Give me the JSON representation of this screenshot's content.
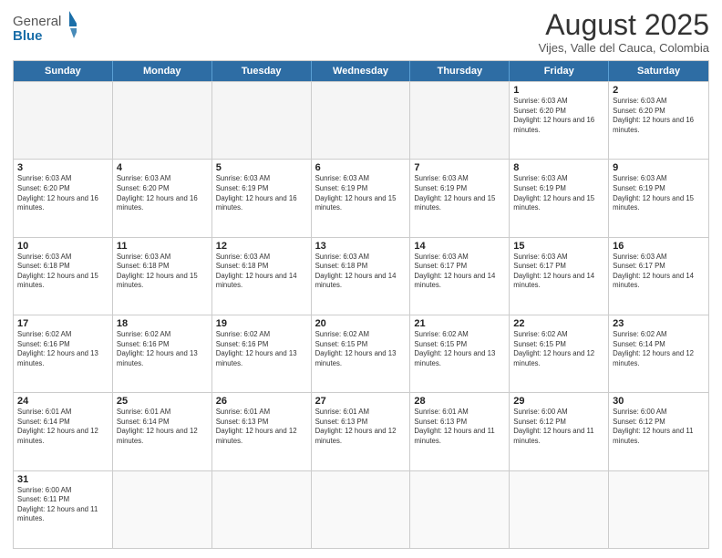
{
  "header": {
    "logo_general": "General",
    "logo_blue": "Blue",
    "month_title": "August 2025",
    "subtitle": "Vijes, Valle del Cauca, Colombia"
  },
  "weekdays": [
    "Sunday",
    "Monday",
    "Tuesday",
    "Wednesday",
    "Thursday",
    "Friday",
    "Saturday"
  ],
  "weeks": [
    [
      {
        "day": "",
        "empty": true
      },
      {
        "day": "",
        "empty": true
      },
      {
        "day": "",
        "empty": true
      },
      {
        "day": "",
        "empty": true
      },
      {
        "day": "",
        "empty": true
      },
      {
        "day": "1",
        "sunrise": "6:03 AM",
        "sunset": "6:20 PM",
        "daylight": "12 hours and 16 minutes."
      },
      {
        "day": "2",
        "sunrise": "6:03 AM",
        "sunset": "6:20 PM",
        "daylight": "12 hours and 16 minutes."
      }
    ],
    [
      {
        "day": "3",
        "sunrise": "6:03 AM",
        "sunset": "6:20 PM",
        "daylight": "12 hours and 16 minutes."
      },
      {
        "day": "4",
        "sunrise": "6:03 AM",
        "sunset": "6:20 PM",
        "daylight": "12 hours and 16 minutes."
      },
      {
        "day": "5",
        "sunrise": "6:03 AM",
        "sunset": "6:19 PM",
        "daylight": "12 hours and 16 minutes."
      },
      {
        "day": "6",
        "sunrise": "6:03 AM",
        "sunset": "6:19 PM",
        "daylight": "12 hours and 15 minutes."
      },
      {
        "day": "7",
        "sunrise": "6:03 AM",
        "sunset": "6:19 PM",
        "daylight": "12 hours and 15 minutes."
      },
      {
        "day": "8",
        "sunrise": "6:03 AM",
        "sunset": "6:19 PM",
        "daylight": "12 hours and 15 minutes."
      },
      {
        "day": "9",
        "sunrise": "6:03 AM",
        "sunset": "6:19 PM",
        "daylight": "12 hours and 15 minutes."
      }
    ],
    [
      {
        "day": "10",
        "sunrise": "6:03 AM",
        "sunset": "6:18 PM",
        "daylight": "12 hours and 15 minutes."
      },
      {
        "day": "11",
        "sunrise": "6:03 AM",
        "sunset": "6:18 PM",
        "daylight": "12 hours and 15 minutes."
      },
      {
        "day": "12",
        "sunrise": "6:03 AM",
        "sunset": "6:18 PM",
        "daylight": "12 hours and 14 minutes."
      },
      {
        "day": "13",
        "sunrise": "6:03 AM",
        "sunset": "6:18 PM",
        "daylight": "12 hours and 14 minutes."
      },
      {
        "day": "14",
        "sunrise": "6:03 AM",
        "sunset": "6:17 PM",
        "daylight": "12 hours and 14 minutes."
      },
      {
        "day": "15",
        "sunrise": "6:03 AM",
        "sunset": "6:17 PM",
        "daylight": "12 hours and 14 minutes."
      },
      {
        "day": "16",
        "sunrise": "6:03 AM",
        "sunset": "6:17 PM",
        "daylight": "12 hours and 14 minutes."
      }
    ],
    [
      {
        "day": "17",
        "sunrise": "6:02 AM",
        "sunset": "6:16 PM",
        "daylight": "12 hours and 13 minutes."
      },
      {
        "day": "18",
        "sunrise": "6:02 AM",
        "sunset": "6:16 PM",
        "daylight": "12 hours and 13 minutes."
      },
      {
        "day": "19",
        "sunrise": "6:02 AM",
        "sunset": "6:16 PM",
        "daylight": "12 hours and 13 minutes."
      },
      {
        "day": "20",
        "sunrise": "6:02 AM",
        "sunset": "6:15 PM",
        "daylight": "12 hours and 13 minutes."
      },
      {
        "day": "21",
        "sunrise": "6:02 AM",
        "sunset": "6:15 PM",
        "daylight": "12 hours and 13 minutes."
      },
      {
        "day": "22",
        "sunrise": "6:02 AM",
        "sunset": "6:15 PM",
        "daylight": "12 hours and 12 minutes."
      },
      {
        "day": "23",
        "sunrise": "6:02 AM",
        "sunset": "6:14 PM",
        "daylight": "12 hours and 12 minutes."
      }
    ],
    [
      {
        "day": "24",
        "sunrise": "6:01 AM",
        "sunset": "6:14 PM",
        "daylight": "12 hours and 12 minutes."
      },
      {
        "day": "25",
        "sunrise": "6:01 AM",
        "sunset": "6:14 PM",
        "daylight": "12 hours and 12 minutes."
      },
      {
        "day": "26",
        "sunrise": "6:01 AM",
        "sunset": "6:13 PM",
        "daylight": "12 hours and 12 minutes."
      },
      {
        "day": "27",
        "sunrise": "6:01 AM",
        "sunset": "6:13 PM",
        "daylight": "12 hours and 12 minutes."
      },
      {
        "day": "28",
        "sunrise": "6:01 AM",
        "sunset": "6:13 PM",
        "daylight": "12 hours and 11 minutes."
      },
      {
        "day": "29",
        "sunrise": "6:00 AM",
        "sunset": "6:12 PM",
        "daylight": "12 hours and 11 minutes."
      },
      {
        "day": "30",
        "sunrise": "6:00 AM",
        "sunset": "6:12 PM",
        "daylight": "12 hours and 11 minutes."
      }
    ],
    [
      {
        "day": "31",
        "sunrise": "6:00 AM",
        "sunset": "6:11 PM",
        "daylight": "12 hours and 11 minutes."
      },
      {
        "day": "",
        "empty": true
      },
      {
        "day": "",
        "empty": true
      },
      {
        "day": "",
        "empty": true
      },
      {
        "day": "",
        "empty": true
      },
      {
        "day": "",
        "empty": true
      },
      {
        "day": "",
        "empty": true
      }
    ]
  ]
}
